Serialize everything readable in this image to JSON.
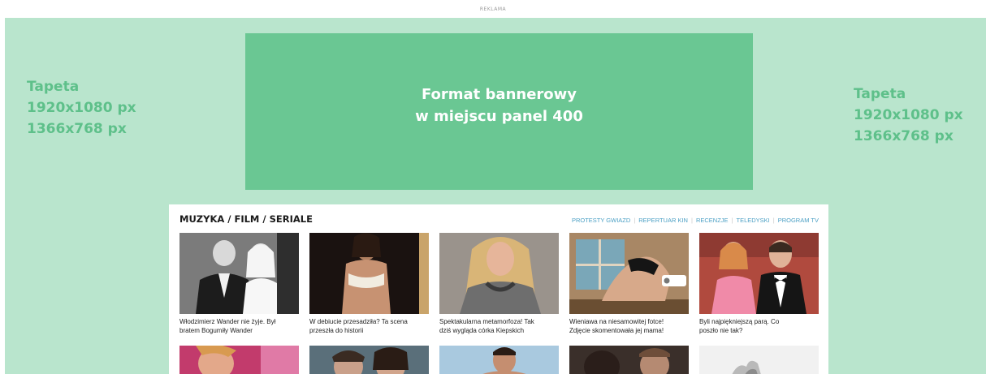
{
  "ad_label": "REKLAMA",
  "wallpaper": {
    "left": [
      "Tapeta",
      "1920x1080 px",
      "1366x768 px"
    ],
    "right": [
      "Tapeta",
      "1920x1080 px",
      "1366x768 px"
    ]
  },
  "banner": {
    "lines": [
      "Format bannerowy",
      "w miejscu panel 400"
    ]
  },
  "section": {
    "title": "MUZYKA / FILM / SERIALE",
    "links": [
      "PROTESTY GWIAZD",
      "REPERTUAR KIN",
      "RECENZJE",
      "TELEDYSKI",
      "PROGRAM TV"
    ]
  },
  "articles": [
    {
      "line1": "Włodzimierz Wander nie żyje. Był",
      "line2": "bratem Bogumiły Wander"
    },
    {
      "line1": "W debiucie przesadziła? Ta scena",
      "line2": "przeszła do historii"
    },
    {
      "line1": "Spektakularna metamorfoza! Tak",
      "line2": "dziś wygląda córka Kiepskich"
    },
    {
      "line1": "Wieniawa na niesamowitej fotce!",
      "line2": "Zdjęcie skomentowała jej mama!"
    },
    {
      "line1": "Byli najpiękniejszą parą. Co",
      "line2": "poszło nie tak?"
    }
  ],
  "colors": {
    "wallpaper": "#b9e5cd",
    "banner": "#6ac793",
    "wall_text": "#5ec08a",
    "link": "#4a9fc4"
  }
}
